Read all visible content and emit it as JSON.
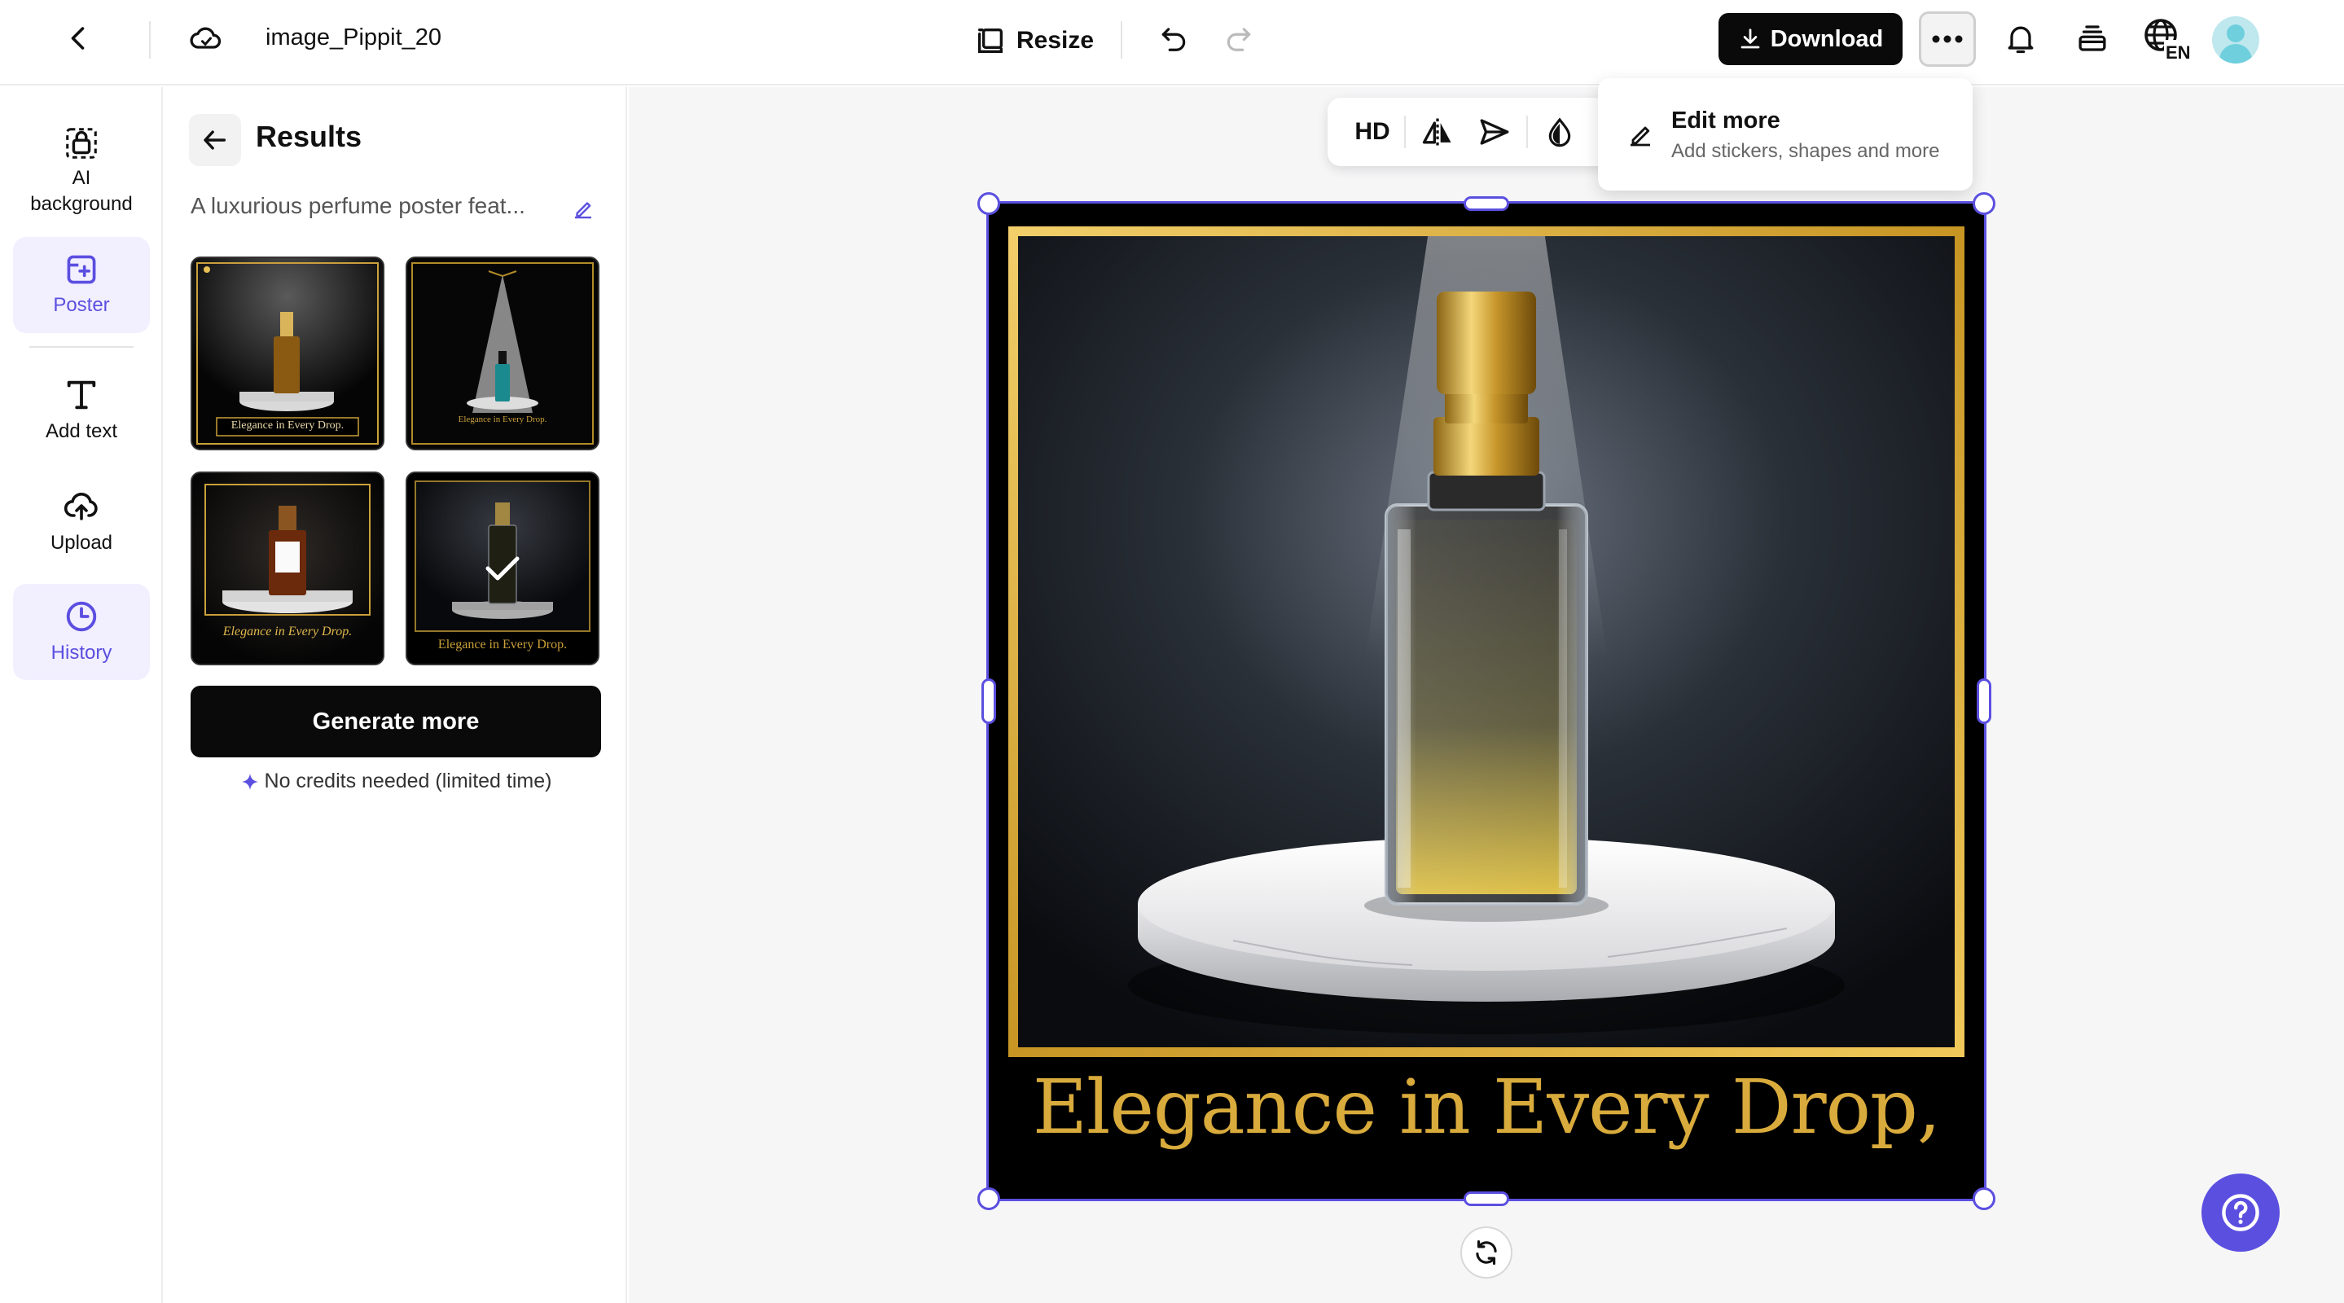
{
  "header": {
    "file_name": "image_Pippit_20",
    "resize_label": "Resize",
    "download_label": "Download",
    "language_code": "EN"
  },
  "sidebar": {
    "items": [
      {
        "label": "AI background",
        "icon": "ai-background-icon",
        "active": false
      },
      {
        "label": "Poster",
        "icon": "poster-icon",
        "active": true
      },
      {
        "label": "Add text",
        "icon": "text-icon",
        "active": false
      },
      {
        "label": "Upload",
        "icon": "upload-icon",
        "active": false
      },
      {
        "label": "History",
        "icon": "history-icon",
        "active": true
      }
    ]
  },
  "results": {
    "title": "Results",
    "prompt": "A luxurious perfume poster feat...",
    "thumbnails": [
      {
        "caption": "Elegance in Every Drop.",
        "selected": false
      },
      {
        "caption": "Elegance in Every Drop.",
        "selected": false
      },
      {
        "caption": "Elegance in Every Drop.",
        "selected": false
      },
      {
        "caption": "Elegance in Every Drop.",
        "selected": true
      }
    ],
    "generate_label": "Generate more",
    "credits_note": "No credits needed (limited time)"
  },
  "canvas_toolbar": {
    "hd_label": "HD"
  },
  "edit_menu": {
    "title": "Edit more",
    "subtitle": "Add stickers, shapes and more"
  },
  "poster": {
    "tagline": "Elegance in Every Drop,"
  },
  "colors": {
    "accent": "#5b4fe0",
    "gold": "#d4a93a",
    "button_dark": "#0a0a0a"
  }
}
